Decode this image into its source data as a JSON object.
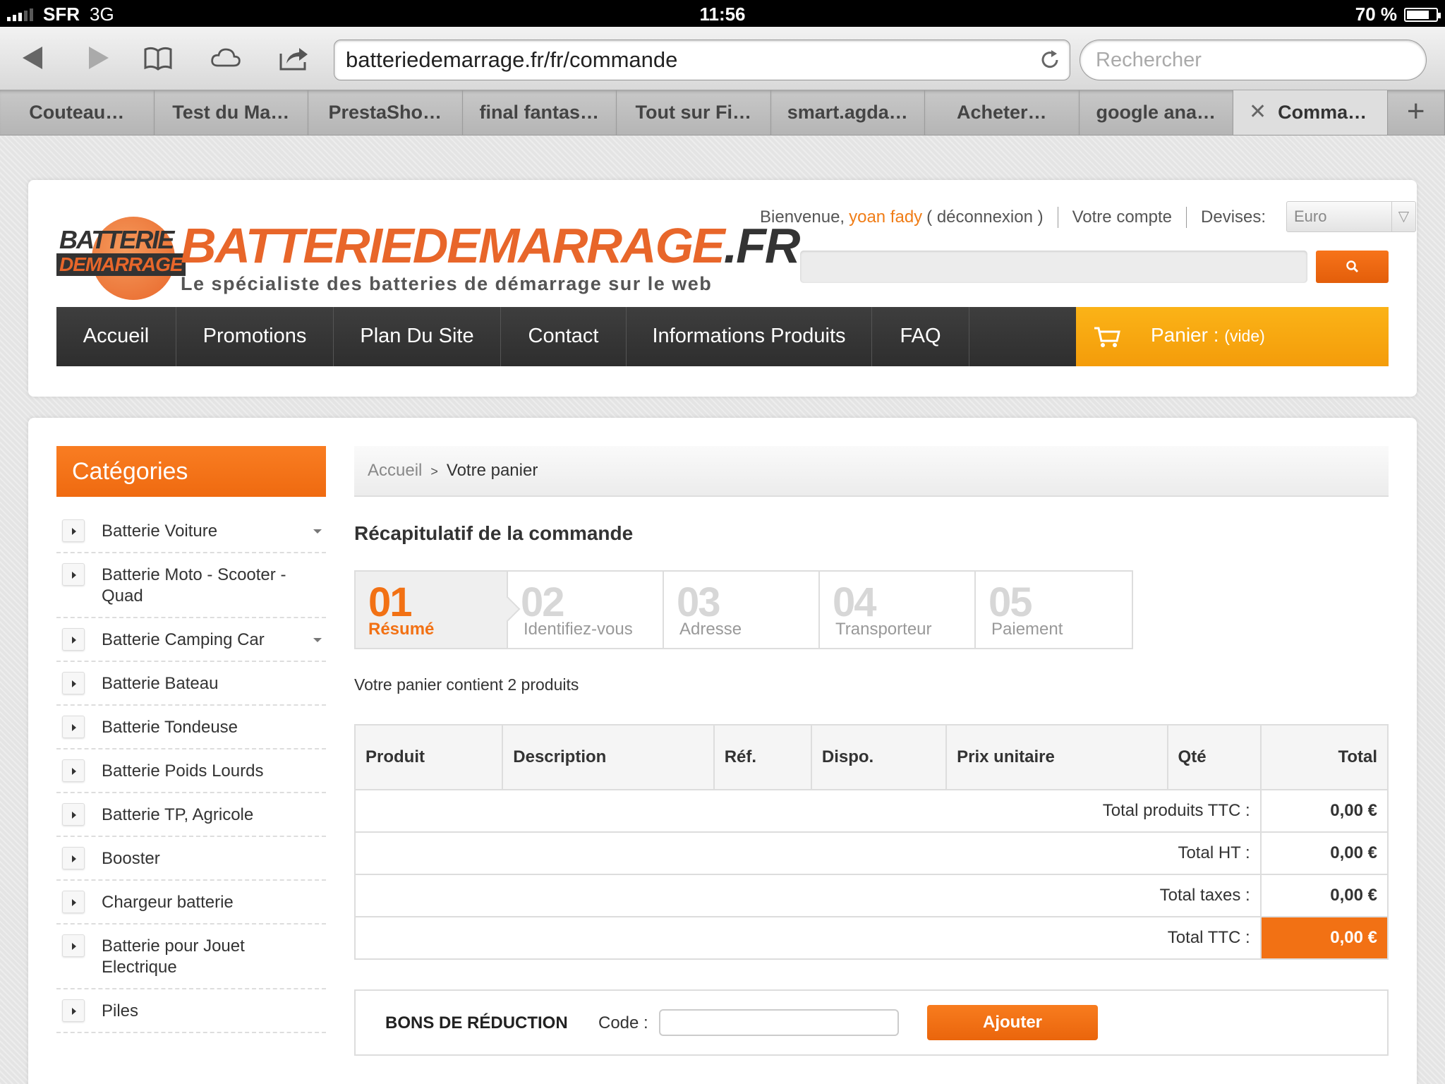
{
  "status_bar": {
    "carrier": "SFR",
    "network": "3G",
    "time": "11:56",
    "battery": "70 %"
  },
  "browser": {
    "url": "batteriedemarrage.fr/fr/commande",
    "search_placeholder": "Rechercher",
    "tabs": [
      {
        "label": "Couteau…"
      },
      {
        "label": "Test du Ma…"
      },
      {
        "label": "PrestaSho…"
      },
      {
        "label": "final fantas…"
      },
      {
        "label": "Tout sur Fi…"
      },
      {
        "label": "smart.agda…"
      },
      {
        "label": "Acheter…"
      },
      {
        "label": "google ana…"
      },
      {
        "label": "Comma…",
        "active": true
      }
    ],
    "close_glyph": "✕",
    "plus_glyph": "+"
  },
  "header": {
    "logo": {
      "badge_line1": "BATTERIE",
      "badge_line2": "DEMARRAGE",
      "main": "BATTERIEDEMARRAGE",
      "main_suffix": ".FR",
      "tagline": "Le spécialiste des batteries de démarrage sur le web"
    },
    "welcome": "Bienvenue,",
    "user_name": "yoan fady",
    "logout": "( déconnexion )",
    "account": "Votre compte",
    "currency_label": "Devises:",
    "currency_value": "Euro",
    "caret_glyph": "▽"
  },
  "nav": {
    "items": [
      "Accueil",
      "Promotions",
      "Plan Du Site",
      "Contact",
      "Informations Produits",
      "FAQ"
    ],
    "cart_label": "Panier :",
    "cart_state": "(vide)"
  },
  "sidebar": {
    "title": "Catégories",
    "items": [
      {
        "label": "Batterie Voiture",
        "dropdown": true
      },
      {
        "label": "Batterie Moto - Scooter - Quad",
        "dropdown": false
      },
      {
        "label": "Batterie Camping Car",
        "dropdown": true
      },
      {
        "label": "Batterie Bateau",
        "dropdown": false
      },
      {
        "label": "Batterie Tondeuse",
        "dropdown": false
      },
      {
        "label": "Batterie Poids Lourds",
        "dropdown": false
      },
      {
        "label": "Batterie TP, Agricole",
        "dropdown": false
      },
      {
        "label": "Booster",
        "dropdown": false
      },
      {
        "label": "Chargeur batterie",
        "dropdown": false
      },
      {
        "label": "Batterie pour Jouet Electrique",
        "dropdown": false
      },
      {
        "label": "Piles",
        "dropdown": false
      }
    ]
  },
  "main": {
    "breadcrumb_home": "Accueil",
    "breadcrumb_sep": ">",
    "breadcrumb_current": "Votre panier",
    "title": "Récapitulatif de la commande",
    "steps": [
      {
        "num": "01",
        "name": "Résumé",
        "active": true
      },
      {
        "num": "02",
        "name": "Identifiez-vous",
        "active": false
      },
      {
        "num": "03",
        "name": "Adresse",
        "active": false
      },
      {
        "num": "04",
        "name": "Transporteur",
        "active": false
      },
      {
        "num": "05",
        "name": "Paiement",
        "active": false
      }
    ],
    "cart_count": "Votre panier contient 2 produits",
    "table": {
      "headers": [
        "Produit",
        "Description",
        "Réf.",
        "Dispo.",
        "Prix unitaire",
        "Qté",
        "Total"
      ],
      "totals": [
        {
          "label": "Total produits TTC :",
          "value": "0,00 €"
        },
        {
          "label": "Total HT :",
          "value": "0,00 €"
        },
        {
          "label": "Total taxes :",
          "value": "0,00 €"
        },
        {
          "label": "Total TTC :",
          "value": "0,00 €"
        }
      ]
    },
    "voucher": {
      "title": "BONS DE RÉDUCTION",
      "code_label": "Code :",
      "code_value": "",
      "button": "Ajouter"
    }
  },
  "colors": {
    "accent": "#f27114",
    "cart_bg": "#f9a90f",
    "nav_bg": "#363636"
  }
}
